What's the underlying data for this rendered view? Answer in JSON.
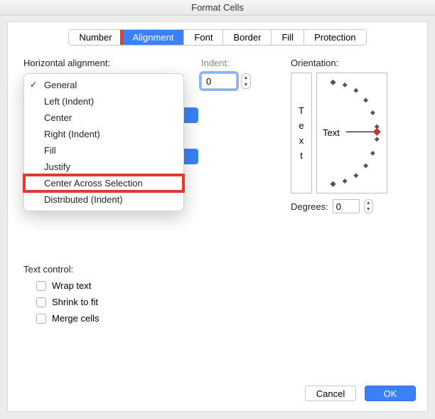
{
  "title": "Format Cells",
  "tabs": {
    "number": "Number",
    "alignment": "Alignment",
    "font": "Font",
    "border": "Border",
    "fill": "Fill",
    "protection": "Protection"
  },
  "labels": {
    "horizontal": "Horizontal alignment:",
    "indent": "Indent:",
    "orientation": "Orientation:",
    "degrees": "Degrees:",
    "text_control": "Text control:",
    "text_word": "Text"
  },
  "horizontal_options": [
    "General",
    "Left (Indent)",
    "Center",
    "Right (Indent)",
    "Fill",
    "Justify",
    "Center Across Selection",
    "Distributed (Indent)"
  ],
  "horizontal_selected_index": 0,
  "highlighted_option_index": 6,
  "indent_value": "0",
  "degrees_value": "0",
  "vertical_text_letters": [
    "T",
    "e",
    "x",
    "t"
  ],
  "text_control_options": {
    "wrap": "Wrap text",
    "shrink": "Shrink to fit",
    "merge": "Merge cells"
  },
  "buttons": {
    "cancel": "Cancel",
    "ok": "OK"
  }
}
